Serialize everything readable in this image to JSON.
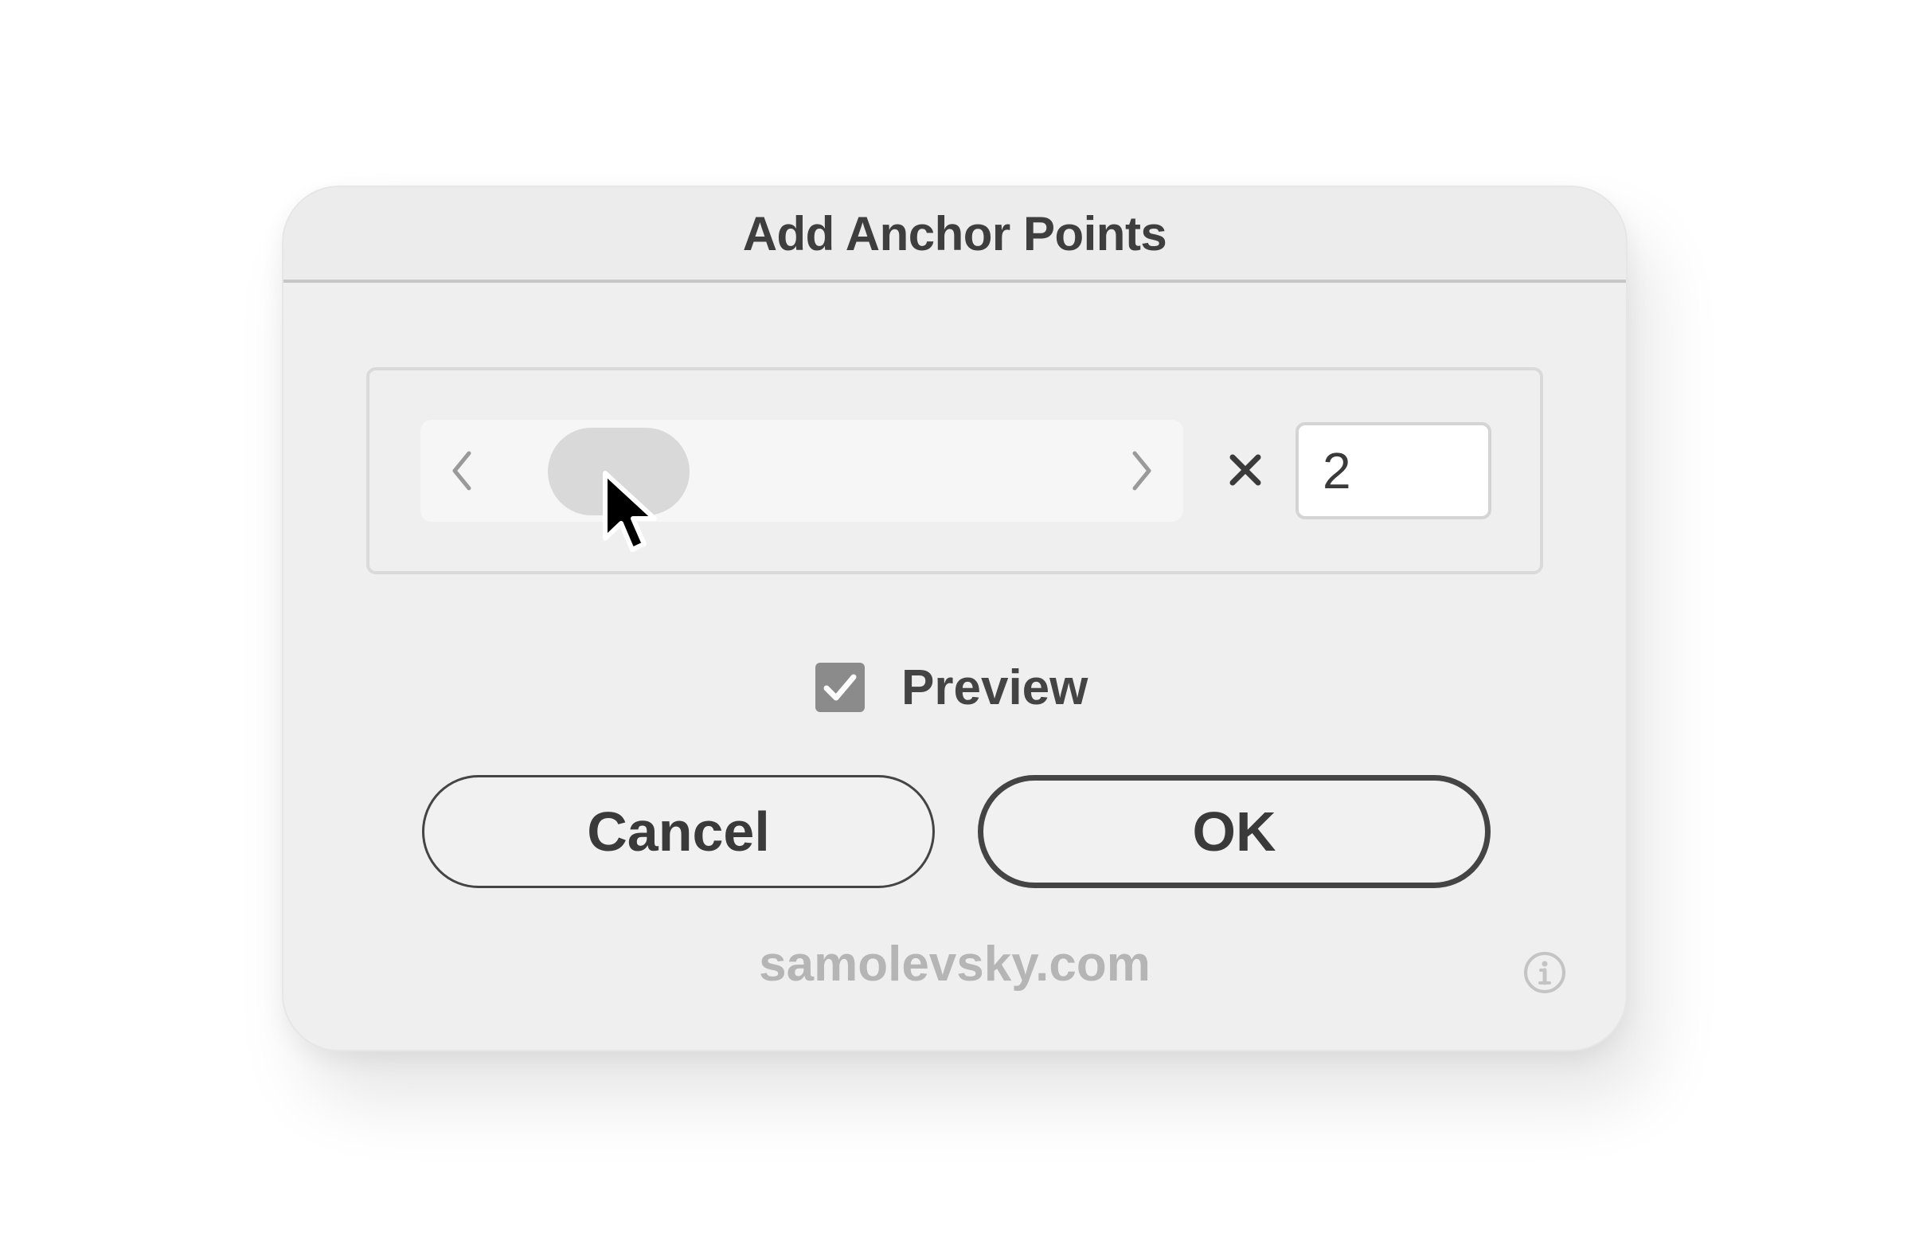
{
  "dialog": {
    "title": "Add Anchor Points",
    "slider": {
      "left_arrow_icon": "chevron-left-icon",
      "right_arrow_icon": "chevron-right-icon",
      "value_fraction": 0.1
    },
    "multiply_symbol": "×",
    "multiplier_value": "2",
    "preview": {
      "label": "Preview",
      "checked": true
    },
    "buttons": {
      "cancel_label": "Cancel",
      "ok_label": "OK"
    },
    "footer_text": "samolevsky.com",
    "info_icon": "info-icon"
  },
  "colors": {
    "dialog_bg": "#efefef",
    "text": "#3e3e3e",
    "thumb": "#d9d9d9",
    "checkbox": "#8b8b8b",
    "footer_text": "#b5b5b5"
  }
}
